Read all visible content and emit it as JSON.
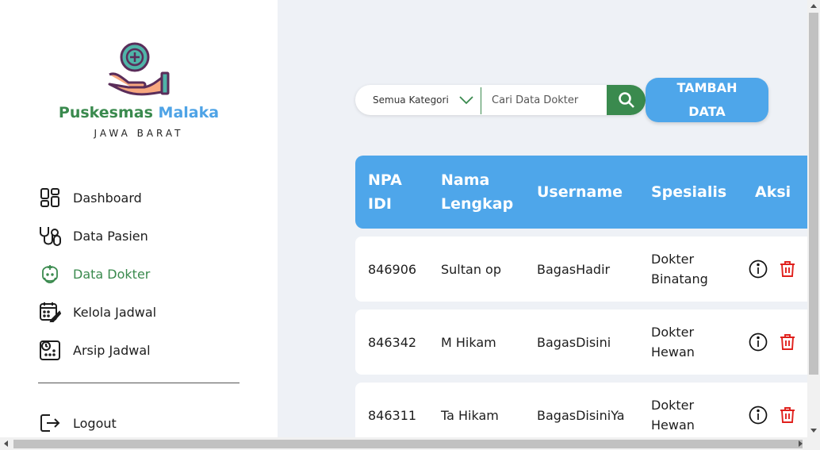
{
  "brand": {
    "name_part1": "Puskesmas",
    "name_part2": "Malaka",
    "region": "JAWA BARAT"
  },
  "sidebar": {
    "items": [
      {
        "label": "Dashboard",
        "icon": "dashboard-icon",
        "active": false
      },
      {
        "label": "Data Pasien",
        "icon": "stethoscope-icon",
        "active": false
      },
      {
        "label": "Data Dokter",
        "icon": "doctor-icon",
        "active": true
      },
      {
        "label": "Kelola Jadwal",
        "icon": "calendar-edit-icon",
        "active": false
      },
      {
        "label": "Arsip Jadwal",
        "icon": "archive-schedule-icon",
        "active": false
      }
    ],
    "logout_label": "Logout"
  },
  "toolbar": {
    "category_value": "Semua Kategori",
    "search_placeholder": "Cari Data Dokter",
    "add_label": "TAMBAH DATA"
  },
  "table": {
    "headers": {
      "npa": "NPA IDI",
      "nama": "Nama Lengkap",
      "username": "Username",
      "spesialis": "Spesialis",
      "aksi": "Aksi"
    },
    "rows": [
      {
        "npa": "846906",
        "nama": "Sultan op",
        "username": "BagasHadir",
        "spesialis": "Dokter Binatang"
      },
      {
        "npa": "846342",
        "nama": "M Hikam",
        "username": "BagasDisini",
        "spesialis": "Dokter Hewan"
      },
      {
        "npa": "846311",
        "nama": "Ta Hikam",
        "username": "BagasDisiniYa",
        "spesialis": "Dokter Hewan"
      }
    ]
  },
  "colors": {
    "brand_green": "#3a8a4e",
    "brand_blue": "#4ea6ea",
    "delete_red": "#e0201c",
    "background": "#eef1f6"
  }
}
